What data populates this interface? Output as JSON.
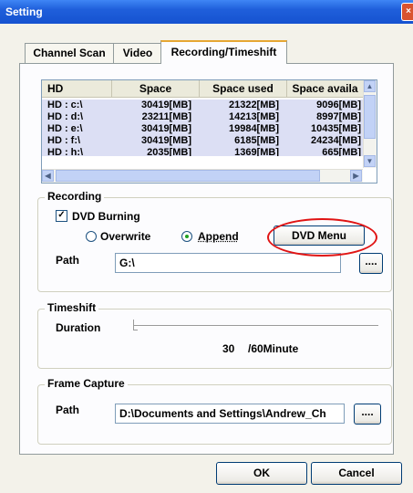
{
  "window": {
    "title": "Setting",
    "close_glyph": "×"
  },
  "tabs": [
    {
      "label": "Channel Scan"
    },
    {
      "label": "Video"
    },
    {
      "label": "Recording/Timeshift",
      "active": true
    }
  ],
  "drives": {
    "columns": [
      "HD",
      "Space",
      "Space used",
      "Space availa"
    ],
    "rows": [
      [
        "HD : c:\\",
        "30419[MB]",
        "21322[MB]",
        "9096[MB]"
      ],
      [
        "HD : d:\\",
        "23211[MB]",
        "14213[MB]",
        "8997[MB]"
      ],
      [
        "HD : e:\\",
        "30419[MB]",
        "19984[MB]",
        "10435[MB]"
      ],
      [
        "HD : f:\\",
        "30419[MB]",
        "6185[MB]",
        "24234[MB]"
      ],
      [
        "HD : h:\\",
        "2035[MB]",
        "1369[MB]",
        "665[MB]"
      ]
    ]
  },
  "recording": {
    "title": "Recording",
    "dvd_burning_label": "DVD Burning",
    "dvd_burning_checked": true,
    "overwrite_label": "Overwrite",
    "append_label": "Append",
    "selected_mode": "Append",
    "dvd_menu_label": "DVD Menu",
    "path_label": "Path",
    "path_value": "G:\\",
    "browse_label": "...."
  },
  "timeshift": {
    "title": "Timeshift",
    "duration_label": "Duration",
    "duration_value": "30",
    "duration_max": "/60Minute"
  },
  "frame_capture": {
    "title": "Frame Capture",
    "path_label": "Path",
    "path_value": "D:\\Documents and Settings\\Andrew_Ch",
    "browse_label": "...."
  },
  "footer": {
    "ok_label": "OK",
    "cancel_label": "Cancel"
  },
  "accent": {
    "title_bar": "#1f5fdb",
    "highlight_ring": "#e01414",
    "radio_dot": "#21a121"
  }
}
